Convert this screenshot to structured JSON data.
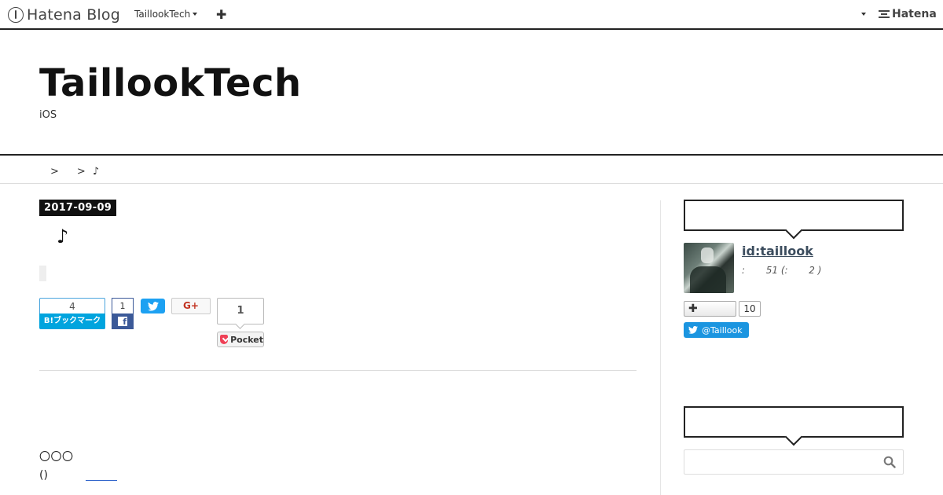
{
  "global_header": {
    "logo_text": "Hatena Blog",
    "blog_menu_label": "TaillookTech",
    "add_label": "✚",
    "hatena_label": "Hatena"
  },
  "blog": {
    "title": "TaillookTech",
    "description": "iOS"
  },
  "breadcrumb": {
    "separator": ">",
    "current": "♪"
  },
  "entry": {
    "date": "2017-09-09",
    "title": "♪",
    "share": {
      "hatena_count": "4",
      "hatena_label": "B!ブックマーク",
      "facebook_count": "1",
      "facebook_icon": "f",
      "google_label": "G+",
      "pocket_count": "1",
      "pocket_label": "Pocket"
    },
    "body_line1": "〇〇〇",
    "body_line2": "()"
  },
  "sidebar": {
    "user_id": "id:taillook",
    "user_stats": ":       51 (:       2 )",
    "follow_label": "✚",
    "follow_count": "10",
    "twitter_label": "@Taillook"
  },
  "colors": {
    "hatena_blue": "#00a4de",
    "facebook": "#3b5998",
    "twitter": "#1da1f2",
    "pocket": "#ef4056",
    "date_bg": "#111111"
  },
  "icons": [
    "hatena-blog-logo-icon",
    "chevron-down-icon",
    "plus-icon",
    "hatena-logo-icon",
    "twitter-bird-icon",
    "facebook-icon",
    "pocket-icon",
    "search-icon"
  ]
}
